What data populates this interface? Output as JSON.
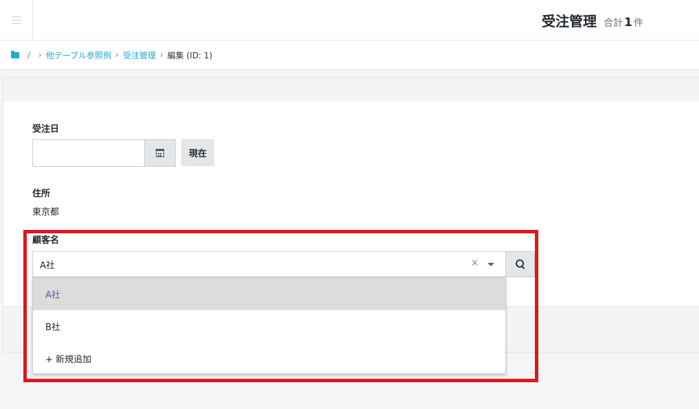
{
  "header": {
    "title": "受注管理",
    "total_prefix": "合計",
    "total_count": "1",
    "total_suffix": "件"
  },
  "breadcrumb": {
    "root_sep": "/",
    "items": [
      "他テーブル参照例",
      "受注管理"
    ],
    "current": "編集 (ID: 1)",
    "separator": "›"
  },
  "form": {
    "order_date": {
      "label": "受注日",
      "value": "",
      "now_button": "現在"
    },
    "address": {
      "label": "住所",
      "value": "東京都"
    },
    "customer": {
      "label": "顧客名",
      "selected": "A社",
      "clear_symbol": "×",
      "options": [
        "A社",
        "B社",
        "+ 新規追加"
      ],
      "highlighted_index": 0
    }
  },
  "icons": {
    "menu": "hamburger-icon",
    "folder": "folder-icon",
    "calendar": "calendar-icon",
    "search": "search-icon",
    "clear": "close-icon",
    "dropdown": "caret-down-icon"
  },
  "colors": {
    "link": "#20a8d8",
    "highlight_box": "#e3141b",
    "selected_option_bg": "#dcdcdc",
    "selected_option_text": "#5b5ea6"
  }
}
